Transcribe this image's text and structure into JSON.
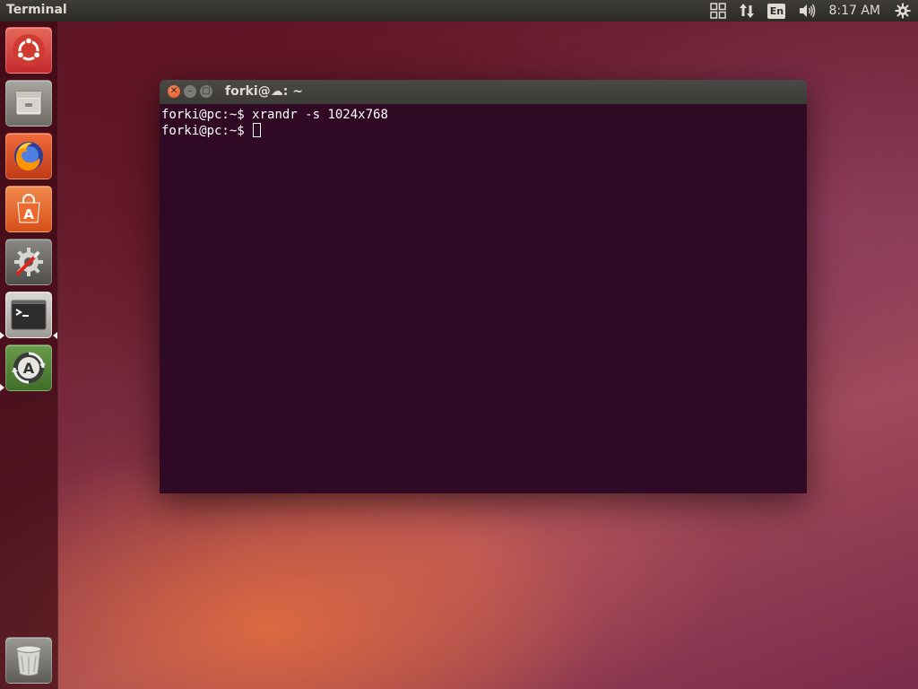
{
  "top_panel": {
    "app_title": "Terminal",
    "language": "En",
    "clock": "8:17 AM",
    "icons": [
      "workspaces-icon",
      "network-icon",
      "keyboard-language-icon",
      "volume-icon",
      "system-gear-icon"
    ]
  },
  "launcher": {
    "items": [
      {
        "name": "Search your computer",
        "icon": "ubuntu-dash-icon"
      },
      {
        "name": "Files",
        "icon": "files-icon"
      },
      {
        "name": "Firefox Web Browser",
        "icon": "firefox-icon"
      },
      {
        "name": "Ubuntu Software",
        "icon": "software-center-icon"
      },
      {
        "name": "System Settings",
        "icon": "system-settings-icon"
      },
      {
        "name": "Terminal",
        "icon": "terminal-icon",
        "running": true,
        "active": true
      },
      {
        "name": "Software Updater",
        "icon": "software-updater-icon",
        "running": true
      },
      {
        "name": "Trash",
        "icon": "trash-icon"
      }
    ]
  },
  "terminal": {
    "title": "forki@☁: ~",
    "lines": [
      {
        "prompt": "forki@pc:~$ ",
        "command": "xrandr -s 1024x768"
      },
      {
        "prompt": "forki@pc:~$ ",
        "command": ""
      }
    ]
  },
  "colors": {
    "terminal_bg": "#300a24",
    "panel_bg": "#3c3b37",
    "close_button": "#e95420"
  }
}
